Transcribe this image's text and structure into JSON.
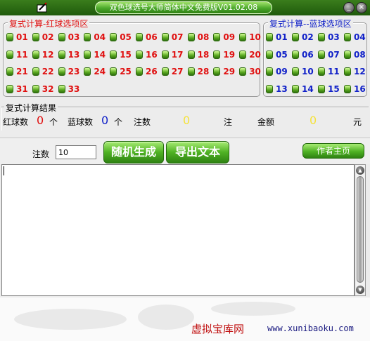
{
  "window": {
    "title": "双色球选号大师简体中文免费版V01.02.08",
    "minimize": "_",
    "close": "×"
  },
  "red_section": {
    "title": "复式计算-红球选项区",
    "balls": [
      "01",
      "02",
      "03",
      "04",
      "05",
      "06",
      "07",
      "08",
      "09",
      "10",
      "11",
      "12",
      "13",
      "14",
      "15",
      "16",
      "17",
      "18",
      "19",
      "20",
      "21",
      "22",
      "23",
      "24",
      "25",
      "26",
      "27",
      "28",
      "29",
      "30",
      "31",
      "32",
      "33"
    ]
  },
  "blue_section": {
    "title": "复式计算--蓝球选项区",
    "balls": [
      "01",
      "02",
      "03",
      "04",
      "05",
      "06",
      "07",
      "08",
      "09",
      "10",
      "11",
      "12",
      "13",
      "14",
      "15",
      "16"
    ]
  },
  "result": {
    "title": "复式计算结果",
    "red_label": "红球数",
    "red_count": "0",
    "red_unit": "个",
    "blue_label": "蓝球数",
    "blue_count": "0",
    "blue_unit": "个",
    "bets_label": "注数",
    "bets_count": "0",
    "bets_unit": "注",
    "amount_label": "金额",
    "amount_value": "0",
    "amount_unit": "元"
  },
  "controls": {
    "bets_label": "注数",
    "bets_value": "10",
    "random_button": "随机生成",
    "export_button": "导出文本",
    "author_button": "作者主页"
  },
  "output": {
    "text": ""
  },
  "footer": {
    "site_name": "虚拟宝库网",
    "url": "www.xunibaoku.com"
  },
  "colors": {
    "red": "#e01010",
    "blue": "#1020c8",
    "green_button": "#4fb224",
    "title_bar": "#2f6e16"
  }
}
